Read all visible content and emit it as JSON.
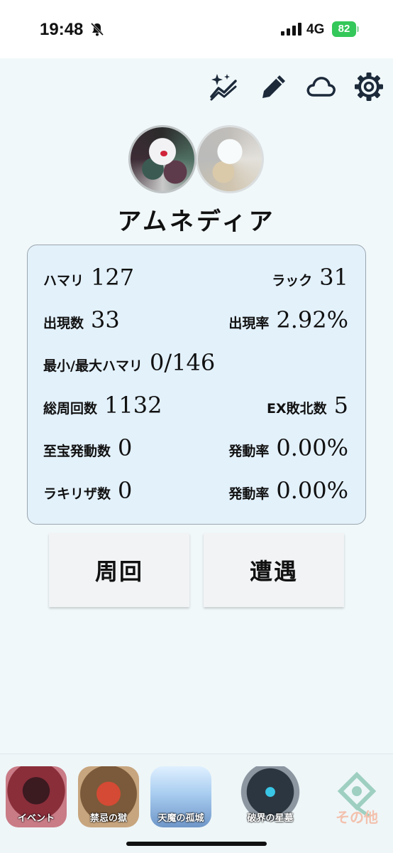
{
  "status_bar": {
    "time": "19:48",
    "network": "4G",
    "battery": "82"
  },
  "toolbar": {
    "icons": [
      "sparkle-chart-icon",
      "pencil-icon",
      "cloud-icon",
      "gear-icon"
    ]
  },
  "character": {
    "name": "アムネディア"
  },
  "stats": {
    "hamari_label": "ハマリ",
    "hamari_value": "127",
    "luck_label": "ラック",
    "luck_value": "31",
    "appear_count_label": "出現数",
    "appear_count_value": "33",
    "appear_rate_label": "出現率",
    "appear_rate_value": "2.92%",
    "minmax_label": "最小/最大ハマリ",
    "minmax_value": "0/146",
    "total_runs_label": "総周回数",
    "total_runs_value": "1132",
    "ex_defeat_label": "EX敗北数",
    "ex_defeat_value": "5",
    "treasure_label": "至宝発動数",
    "treasure_value": "0",
    "treasure_rate_label": "発動率",
    "treasure_rate_value": "0.00%",
    "lucky_label": "ラキリザ数",
    "lucky_value": "0",
    "lucky_rate_label": "発動率",
    "lucky_rate_value": "0.00%"
  },
  "actions": {
    "lap_label": "周回",
    "encounter_label": "遭遇"
  },
  "bottom_nav": [
    {
      "label": "イベント",
      "color": "#8a2e3a"
    },
    {
      "label": "禁忌の獄",
      "color": "#9a3b2c"
    },
    {
      "label": "天魔の孤城",
      "color": "#7fa8d6"
    },
    {
      "label": "破界の星墓",
      "color": "#3b4652"
    },
    {
      "label": "その他",
      "color": "#f1c7b5"
    }
  ],
  "colors": {
    "background": "#f1f8fa",
    "card": "#e3f1fb",
    "battery_green": "#34c759"
  }
}
